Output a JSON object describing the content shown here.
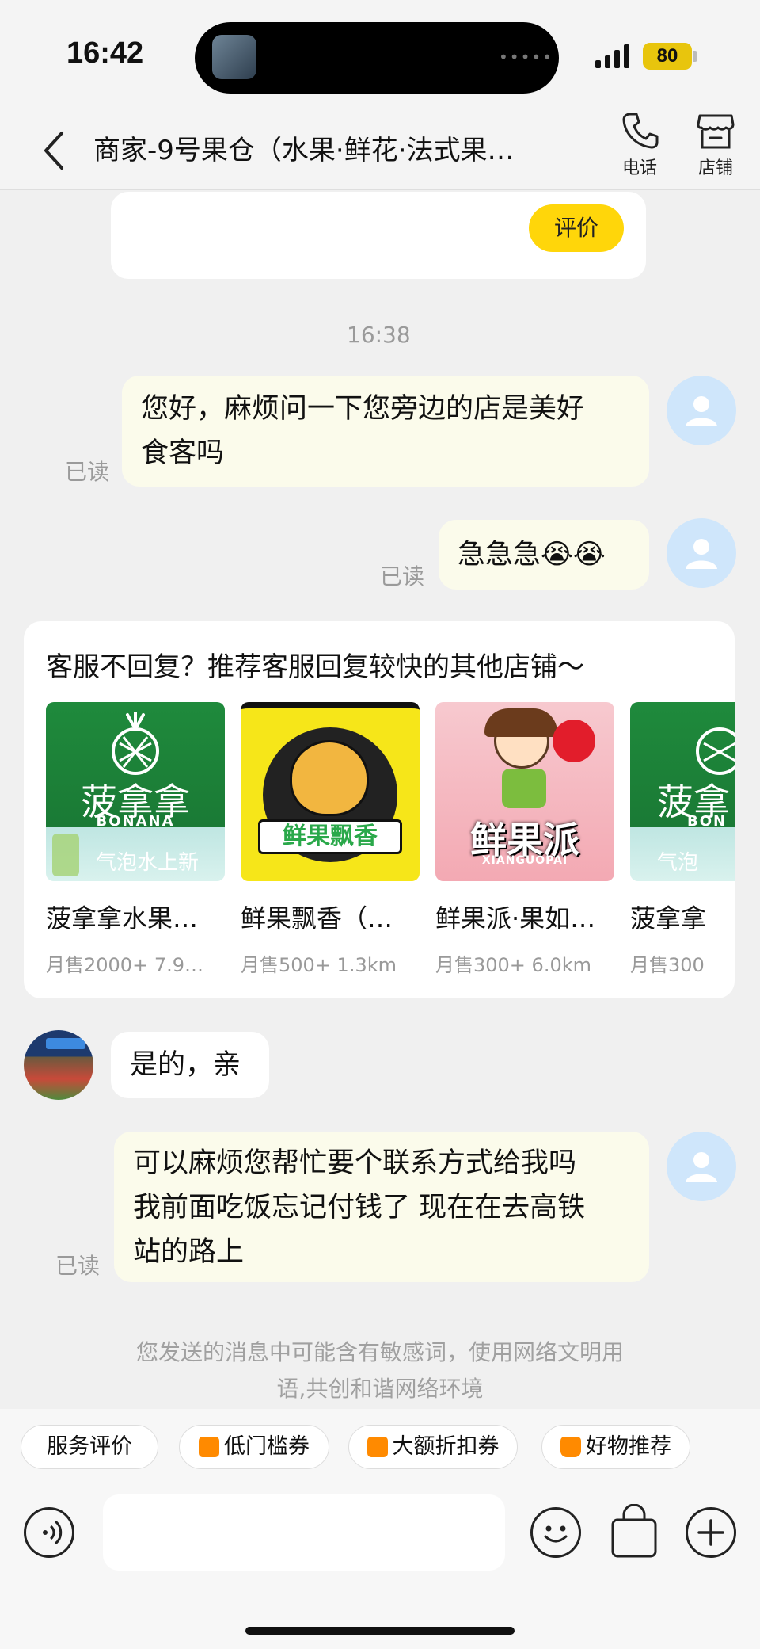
{
  "status_bar": {
    "time": "16:42",
    "dots": "•••••",
    "battery": "80"
  },
  "header": {
    "title": "商家-9号果仓（水果·鲜花·法式果…",
    "phone_label": "电话",
    "shop_label": "店铺"
  },
  "messages": {
    "rate_button": "评价",
    "timestamp": "16:38",
    "m1_line1": "您好，麻烦问一下您旁边的店是美好",
    "m1_line2": "食客吗",
    "m2": "急急急😭😭",
    "read": "已读",
    "reply": "是的，亲",
    "m3_line1": "可以麻烦您帮忙要个联系方式给我吗",
    "m3_line2": "我前面吃饭忘记付钱了 现在在去高铁",
    "m3_line3": "站的路上"
  },
  "recommendation": {
    "title": "客服不回复？推荐客服回复较快的其他店铺～",
    "stores": [
      {
        "name": "菠拿拿水果…",
        "meta": "月售2000+  7.9…",
        "logo_text": "菠拿拿",
        "logo_sub": "BONANA",
        "logo_tag": "气泡水上新"
      },
      {
        "name": "鲜果飘香（…",
        "meta": "月售500+    1.3km",
        "logo_text": "鲜果飘香"
      },
      {
        "name": "鲜果派·果如…",
        "meta": "月售300+   6.0km",
        "logo_text": "鲜果派",
        "logo_sub": "XIANGUOPAI"
      },
      {
        "name": "菠拿拿",
        "meta": "月售300",
        "logo_text": "菠拿",
        "logo_sub": "BON",
        "logo_tag": "气泡"
      }
    ]
  },
  "footer": {
    "notice_line1": "您发送的消息中可能含有敏感词，使用网络文明用",
    "notice_line2": "语,共创和谐网络环境",
    "chips": [
      "服务评价",
      "低门槛券",
      "大额折扣券",
      "好物推荐"
    ]
  },
  "colors": {
    "accent": "#ffd60a",
    "bubble_me": "#fbfbeb",
    "avatar_bg": "#cfe6fb",
    "chip_icon": "#ff8a00"
  }
}
